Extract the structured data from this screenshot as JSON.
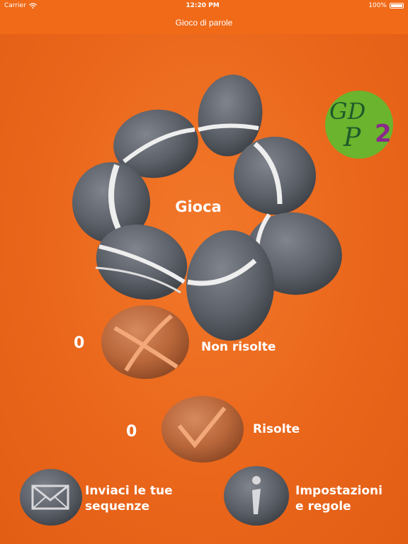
{
  "status_bar": {
    "carrier": "Carrier",
    "time": "12:20 PM",
    "battery": "100%"
  },
  "nav": {
    "title": "Gioco di parole"
  },
  "main": {
    "play_label": "Gioca",
    "logo_text_top": "GD",
    "logo_text_p": "P",
    "logo_number": "2",
    "unsolved": {
      "count": "0",
      "label": "Non risolte"
    },
    "solved": {
      "count": "0",
      "label": "Risolte"
    },
    "send": {
      "line1": "Inviaci le tue",
      "line2": "sequenze"
    },
    "settings": {
      "line1": "Impostazioni",
      "line2": "e regole"
    }
  },
  "colors": {
    "background": "#ea6a1c",
    "bar": "#f06a18",
    "stone_grey": "#5c6068",
    "stone_red": "#b8663a",
    "logo_green": "#6ab42e",
    "logo_purple": "#8a2a8a"
  },
  "icons": {
    "wifi": "wifi-icon",
    "battery": "battery-icon",
    "cross": "cross-icon",
    "check": "checkmark-icon",
    "mail": "envelope-icon",
    "info": "info-icon"
  }
}
